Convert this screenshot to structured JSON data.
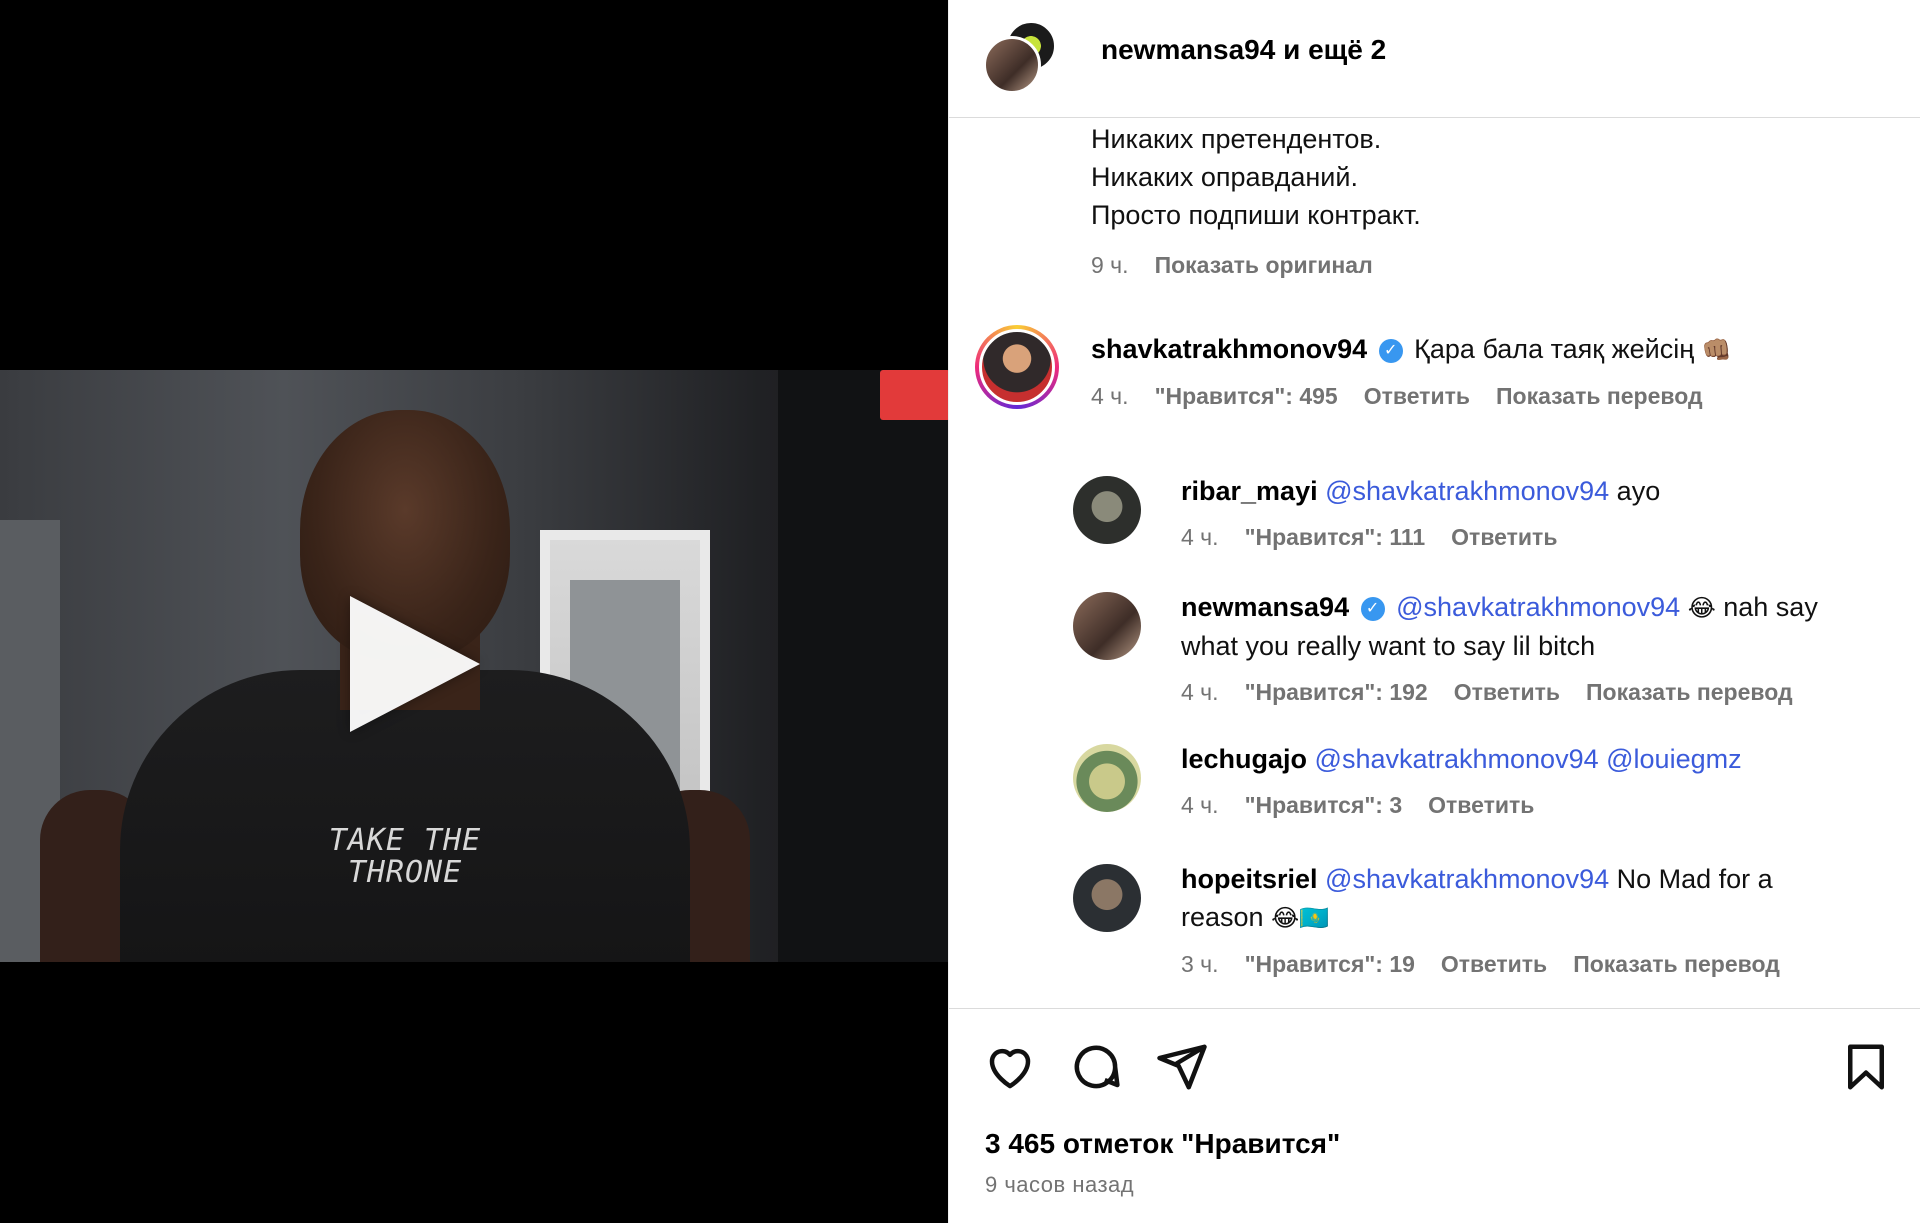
{
  "post": {
    "header_user": "newmansa94",
    "header_rest": " и ещё 2",
    "shirt_text_line1": "TAKE THE",
    "shirt_text_line2": "THRONE"
  },
  "caption": {
    "lines": [
      "Никаких претендентов.",
      "Никаких оправданий.",
      "Просто подпиши контракт."
    ],
    "time": "9 ч.",
    "show_original": "Показать оригинал"
  },
  "comments": [
    {
      "user": "shavkatrakhmonov94",
      "verified": true,
      "text": "Қара бала таяқ жейсің",
      "emoji": "👊🏽",
      "time": "4 ч.",
      "likes": "\"Нравится\": 495",
      "reply": "Ответить",
      "translate": "Показать перевод"
    }
  ],
  "replies": [
    {
      "user": "ribar_mayi",
      "mention": "@shavkatrakhmonov94",
      "text": " ayo",
      "time": "4 ч.",
      "likes": "\"Нравится\": 111",
      "reply": "Ответить"
    },
    {
      "user": "newmansa94",
      "verified": true,
      "mention": "@shavkatrakhmonov94",
      "emoji": "😂",
      "text_line1": " nah say",
      "text_line2": "what you really want to say lil bitch",
      "time": "4 ч.",
      "likes": "\"Нравится\": 192",
      "reply": "Ответить",
      "translate": "Показать перевод"
    },
    {
      "user": "lechugajo",
      "mention": "@shavkatrakhmonov94",
      "mention2": "@louiegmz",
      "time": "4 ч.",
      "likes": "\"Нравится\": 3",
      "reply": "Ответить"
    },
    {
      "user": "hopeitsriel",
      "mention": "@shavkatrakhmonov94",
      "text_line1": " No Mad for a",
      "text_line2": "reason",
      "emoji": "😂🇰🇿",
      "time": "3 ч.",
      "likes": "\"Нравится\": 19",
      "reply": "Ответить",
      "translate": "Показать перевод"
    }
  ],
  "footer": {
    "likes_total": "3 465 отметок \"Нравится\"",
    "posted_ago": "9 часов назад"
  },
  "icons": {
    "like": "heart-icon",
    "comment": "comment-bubble-icon",
    "share": "paper-plane-icon",
    "save": "bookmark-icon",
    "play": "play-icon",
    "verified": "verified-badge-icon"
  }
}
